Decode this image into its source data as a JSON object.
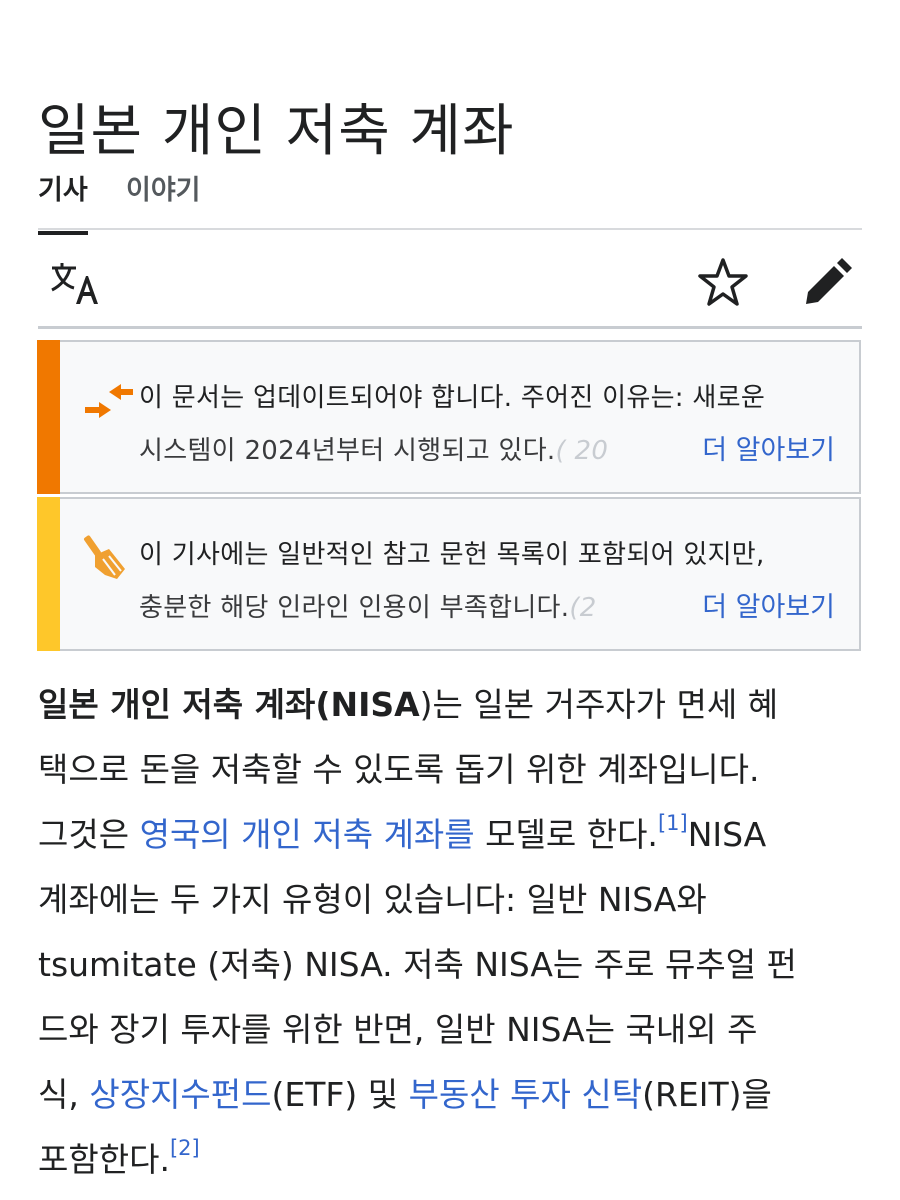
{
  "page": {
    "title": "일본 개인 저축 계좌"
  },
  "tabs": {
    "article": "기사",
    "talk": "이야기"
  },
  "toolbar": {
    "translate_icon": "translate-icon",
    "watch_icon": "star-icon",
    "edit_icon": "pencil-icon"
  },
  "notices": {
    "update": {
      "icon": "update-arrows-icon",
      "line1": "이 문서는 업데이트되어야 합니다. 주어진 이유는: 새로운",
      "line2": "시스템이 2024년부터 시행되고 있다.",
      "line2_faded": "( 20",
      "learn_more": "더 알아보기",
      "accent": "#f07800"
    },
    "refs": {
      "icon": "broom-icon",
      "line1": "이 기사에는 일반적인 참고 문헌 목록이 포함되어 있지만,",
      "line2": "충분한 해당 인라인 인용이 부족합니다.",
      "line2_faded": "(2",
      "learn_more": "더 알아보기",
      "accent": "#fec72a"
    }
  },
  "article": {
    "r1_bold": "일본 개인 저축 계좌",
    "r1_paren_open": "(",
    "r1_bold2": "NISA",
    "r1_rest": ")는 일본 거주자가 면세 혜",
    "r2": "택으로 돈을 저축할 수 있도록 돕기 위한 계좌입니다.",
    "r3_pre": "그것은 ",
    "r3_link": "영국의 개인 저축 계좌를",
    "r3_mid": " 모델로 한다.",
    "r3_ref": "[1]",
    "r3_post": "NISA",
    "r4": "계좌에는 두 가지 유형이 있습니다: 일반 NISA와",
    "r5": "tsumitate (저축) NISA. 저축 NISA는 주로 뮤추얼 펀",
    "r6": "드와 장기 투자를 위한 반면, 일반 NISA는 국내외 주",
    "r7_pre": "식, ",
    "r7_link1": "상장지수펀드",
    "r7_mid": "(ETF) 및 ",
    "r7_link2": "부동산 투자 신탁",
    "r7_post": "(REIT)을",
    "r8": "포함한다.",
    "r8_ref": "[2]"
  },
  "colors": {
    "link": "#3366cc",
    "text": "#202122"
  }
}
